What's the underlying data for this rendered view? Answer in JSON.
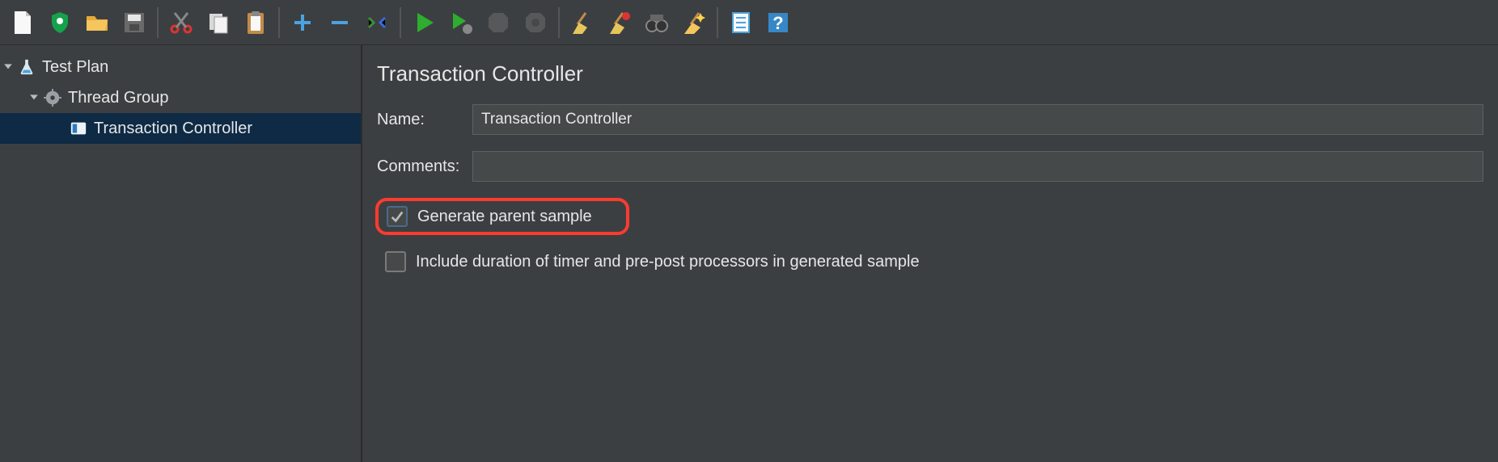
{
  "toolbar": {
    "items": [
      {
        "name": "new-file",
        "sep": false
      },
      {
        "name": "templates",
        "sep": false
      },
      {
        "name": "open",
        "sep": false
      },
      {
        "name": "save",
        "sep": false
      },
      {
        "name": "sep1",
        "sep": true
      },
      {
        "name": "cut",
        "sep": false
      },
      {
        "name": "copy",
        "sep": false
      },
      {
        "name": "paste",
        "sep": false
      },
      {
        "name": "sep2",
        "sep": true
      },
      {
        "name": "expand",
        "sep": false
      },
      {
        "name": "collapse",
        "sep": false
      },
      {
        "name": "toggle",
        "sep": false
      },
      {
        "name": "sep3",
        "sep": true
      },
      {
        "name": "start",
        "sep": false
      },
      {
        "name": "start-no-pause",
        "sep": false
      },
      {
        "name": "stop",
        "sep": false,
        "disabled": true
      },
      {
        "name": "shutdown",
        "sep": false,
        "disabled": true
      },
      {
        "name": "sep4",
        "sep": true
      },
      {
        "name": "clear",
        "sep": false
      },
      {
        "name": "clear-all",
        "sep": false
      },
      {
        "name": "search",
        "sep": false
      },
      {
        "name": "reset-search",
        "sep": false
      },
      {
        "name": "sep5",
        "sep": true
      },
      {
        "name": "function-helper",
        "sep": false
      },
      {
        "name": "help",
        "sep": false
      }
    ]
  },
  "tree": {
    "root": {
      "label": "Test Plan"
    },
    "thread_group": {
      "label": "Thread Group"
    },
    "transaction_controller": {
      "label": "Transaction Controller"
    }
  },
  "panel": {
    "title": "Transaction Controller",
    "name_label": "Name:",
    "name_value": "Transaction Controller",
    "comments_label": "Comments:",
    "comments_value": "",
    "generate_parent_label": "Generate parent sample",
    "generate_parent_checked": true,
    "include_duration_label": "Include duration of timer and pre-post processors in generated sample",
    "include_duration_checked": false
  }
}
